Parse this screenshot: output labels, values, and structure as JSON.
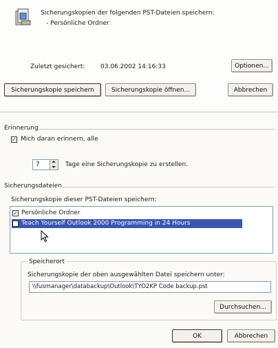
{
  "header": {
    "line1": "Sicherungskopien der folgenden PST-Dateien speichern:",
    "line2": "- Persönliche Ordner",
    "last_saved_label": "Zuletzt gesichert:",
    "last_saved_value": "03.06.2002 14:16:33",
    "options_button": "Optionen..."
  },
  "actions": {
    "save_backup": "Sicherungskopie speichern",
    "open_backup": "Sicherungskopie öffnen...",
    "cancel": "Abbrechen"
  },
  "reminder": {
    "group_title": "Erinnerung",
    "checkbox_label": "Mich daran erinnern, alle",
    "checkbox_checked": "✓",
    "days_value": "7",
    "days_suffix": "Tage eine Sicherungskopie zu erstellen."
  },
  "files": {
    "group_title": "Sicherungsdateien",
    "list_label": "Sicherungskopie dieser PST-Dateien speichern:",
    "items": [
      {
        "label": "Persönliche Ordner",
        "checked": "✓"
      },
      {
        "label": "Teach Yourself Outlook 2000 Programming in 24 Hours",
        "checked": ""
      }
    ]
  },
  "location": {
    "group_title": "Speicherort",
    "label": "Sicherungskopie der oben ausgewählten Datei speichern unter:",
    "path": "\\\\fusmanager\\databackup\\Outlook\\TYO2KP Code backup.pst",
    "browse_button": "Durchsuchen..."
  },
  "footer": {
    "ok": "OK",
    "cancel": "Abbrechen"
  },
  "colors": {
    "selection": "#3a56b0",
    "selection_text": "#ffffff"
  }
}
